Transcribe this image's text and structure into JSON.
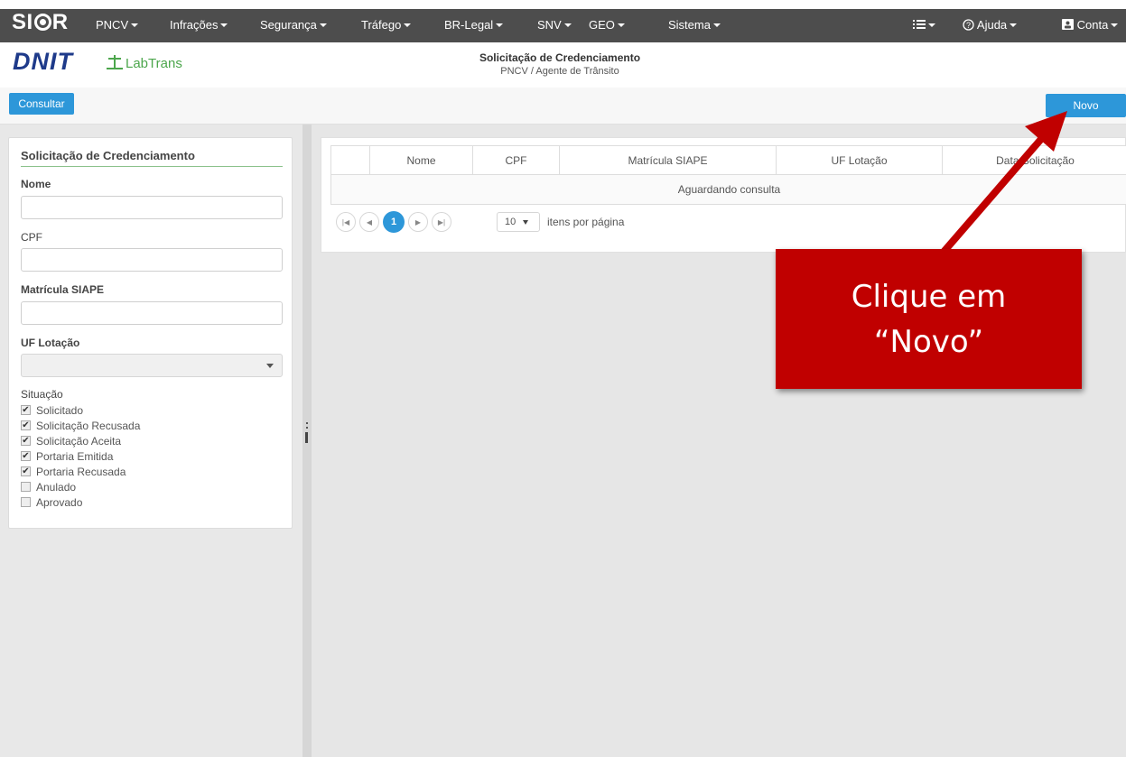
{
  "navbar": {
    "brand": "SIOR",
    "brand_parts": [
      "SI",
      "R"
    ],
    "menu": [
      {
        "label": "PNCV"
      },
      {
        "label": "Infrações"
      },
      {
        "label": "Segurança"
      },
      {
        "label": "Tráfego"
      },
      {
        "label": "BR-Legal"
      },
      {
        "label": "SNV"
      },
      {
        "label": "GEO"
      },
      {
        "label": "Sistema"
      }
    ],
    "list_icon": "list-icon",
    "help_label": "Ajuda",
    "account_label": "Conta"
  },
  "header": {
    "logo_dnit": "DNIT",
    "logo_labtrans": "LabTrans",
    "title": "Solicitação de Credenciamento",
    "subtitle": "PNCV / Agente de Trânsito"
  },
  "toolbar": {
    "consultar_label": "Consultar",
    "novo_label": "Novo"
  },
  "filter": {
    "title": "Solicitação de Credenciamento",
    "nome_label": "Nome",
    "nome_value": "",
    "cpf_label": "CPF",
    "cpf_value": "",
    "matricula_label": "Matrícula SIAPE",
    "matricula_value": "",
    "uf_label": "UF Lotação",
    "uf_value": "",
    "situacao_label": "Situação",
    "situacao_options": [
      {
        "label": "Solicitado",
        "checked": true
      },
      {
        "label": "Solicitação Recusada",
        "checked": true
      },
      {
        "label": "Solicitação Aceita",
        "checked": true
      },
      {
        "label": "Portaria Emitida",
        "checked": true
      },
      {
        "label": "Portaria Recusada",
        "checked": true
      },
      {
        "label": "Anulado",
        "checked": false
      },
      {
        "label": "Aprovado",
        "checked": false
      }
    ]
  },
  "grid": {
    "columns": [
      "",
      "Nome",
      "CPF",
      "Matrícula SIAPE",
      "UF Lotação",
      "Data Solicitação"
    ],
    "status": "Aguardando consulta",
    "current_page": "1",
    "page_size": "10",
    "page_size_label": "itens por página"
  },
  "annotation": {
    "line1": "Clique em",
    "line2": "“Novo”",
    "color": "#c00000"
  },
  "colors": {
    "navbar": "#4d4d4d",
    "primary": "#2d97d9"
  }
}
